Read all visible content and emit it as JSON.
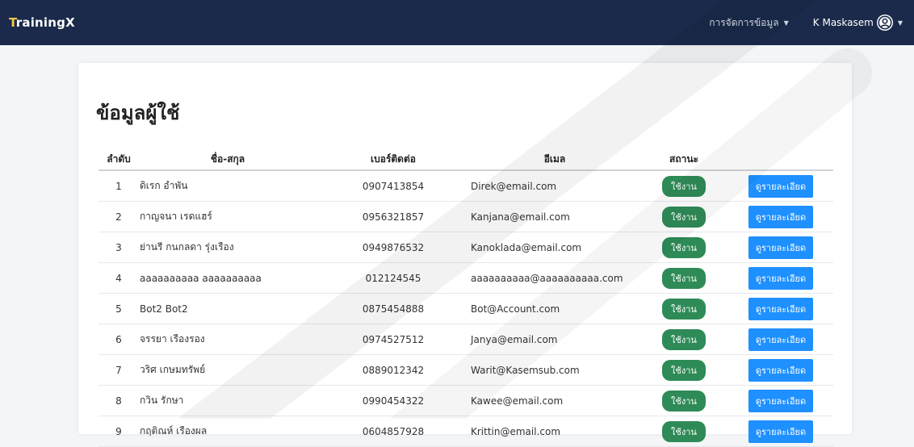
{
  "navbar": {
    "brand_first": "T",
    "brand_rest": "rainingX",
    "data_menu_label": "การจัดการข้อมูล",
    "user_name": "K Maskasem"
  },
  "page": {
    "title": "ข้อมูลผู้ใช้"
  },
  "table": {
    "headers": {
      "order": "ลำดับ",
      "name": "ชื่อ-สกุล",
      "phone": "เบอร์ติดต่อ",
      "email": "อีเมล",
      "status": "สถานะ"
    },
    "rows": [
      {
        "no": "1",
        "name": "ดิเรก อำพัน",
        "phone": "0907413854",
        "email": "Direk@email.com",
        "status": "ใช้งาน",
        "action": "ดูรายละเอียด"
      },
      {
        "no": "2",
        "name": "กาญจนา เรดแฮร์",
        "phone": "0956321857",
        "email": "Kanjana@email.com",
        "status": "ใช้งาน",
        "action": "ดูรายละเอียด"
      },
      {
        "no": "3",
        "name": "ย่านรี กนกลดา รุ่งเรือง",
        "phone": "0949876532",
        "email": "Kanoklada@email.com",
        "status": "ใช้งาน",
        "action": "ดูรายละเอียด"
      },
      {
        "no": "4",
        "name": "aaaaaaaaaa aaaaaaaaaa",
        "phone": "012124545",
        "email": "aaaaaaaaaa@aaaaaaaaaa.com",
        "status": "ใช้งาน",
        "action": "ดูรายละเอียด"
      },
      {
        "no": "5",
        "name": "Bot2 Bot2",
        "phone": "0875454888",
        "email": "Bot@Account.com",
        "status": "ใช้งาน",
        "action": "ดูรายละเอียด"
      },
      {
        "no": "6",
        "name": "จรรยา เรืองรอง",
        "phone": "0974527512",
        "email": "Janya@email.com",
        "status": "ใช้งาน",
        "action": "ดูรายละเอียด"
      },
      {
        "no": "7",
        "name": "วริศ เกษมทรัพย์",
        "phone": "0889012342",
        "email": "Warit@Kasemsub.com",
        "status": "ใช้งาน",
        "action": "ดูรายละเอียด"
      },
      {
        "no": "8",
        "name": "กวิน รักษา",
        "phone": "0990454322",
        "email": "Kawee@email.com",
        "status": "ใช้งาน",
        "action": "ดูรายละเอียด"
      },
      {
        "no": "9",
        "name": "กฤติณห์ เรืองผล",
        "phone": "0604857928",
        "email": "Krittin@email.com",
        "status": "ใช้งาน",
        "action": "ดูรายละเอียด"
      }
    ]
  },
  "colors": {
    "navbar_bg": "#1b2a4a",
    "brand_accent": "#f7c948",
    "status_badge": "#2e8b57",
    "detail_button": "#1e90ff"
  },
  "icons": {
    "user": "user-circle-icon",
    "dropdown": "caret-down-icon"
  }
}
